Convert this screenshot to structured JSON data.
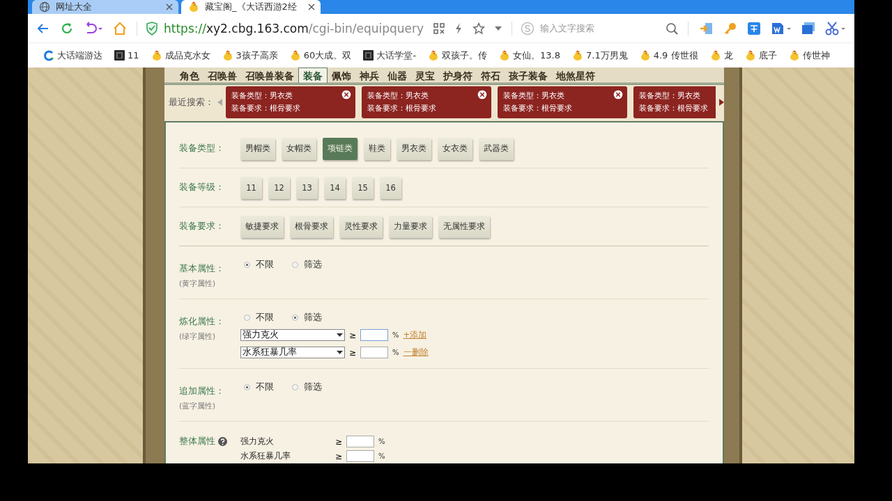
{
  "browser": {
    "tabs": [
      {
        "title": "网址大全",
        "selected": false
      },
      {
        "title": "藏宝阁_《大话西游2经",
        "selected": true
      }
    ],
    "address": {
      "scheme": "https://",
      "host": "xy2.cbg.163.com",
      "path": "/cgi-bin/equipquery"
    },
    "search": {
      "placeholder": "输入文字搜索"
    },
    "bookmarks": [
      "大话端游达",
      "11",
      "成品克水女",
      "3孩子高亲",
      "60大成。双",
      "大话学堂-",
      "双孩子。传",
      "女仙。13.8",
      "7.1万男鬼",
      "4.9 传世很",
      "龙",
      "底子",
      "传世神"
    ]
  },
  "game_tabs": [
    {
      "label": "角色",
      "selected": false
    },
    {
      "label": "召唤兽",
      "selected": false
    },
    {
      "label": "召唤兽装备",
      "selected": false
    },
    {
      "label": "装备",
      "selected": true
    },
    {
      "label": "佩饰",
      "selected": false
    },
    {
      "label": "神兵",
      "selected": false
    },
    {
      "label": "仙器",
      "selected": false
    },
    {
      "label": "灵宝",
      "selected": false
    },
    {
      "label": "护身符",
      "selected": false
    },
    {
      "label": "符石",
      "selected": false
    },
    {
      "label": "孩子装备",
      "selected": false
    },
    {
      "label": "地煞星符",
      "selected": false
    }
  ],
  "recent_searches": {
    "label": "最近搜索：",
    "items": [
      {
        "lines": [
          "装备类型：男衣类",
          "装备要求：根骨要求"
        ]
      },
      {
        "lines": [
          "装备类型：男衣类",
          "装备要求：根骨要求"
        ]
      },
      {
        "lines": [
          "装备类型：男衣类",
          "装备要求：根骨要求"
        ]
      },
      {
        "lines": [
          "装备类型：男衣类",
          "装备要求：根骨要求"
        ]
      }
    ]
  },
  "filters": [
    {
      "label": "装备类型：",
      "options": [
        {
          "label": "男帽类",
          "selected": false
        },
        {
          "label": "女帽类",
          "selected": false
        },
        {
          "label": "项链类",
          "selected": true
        },
        {
          "label": "鞋类",
          "selected": false
        },
        {
          "label": "男衣类",
          "selected": false
        },
        {
          "label": "女衣类",
          "selected": false
        },
        {
          "label": "武器类",
          "selected": false
        }
      ]
    },
    {
      "label": "装备等级：",
      "options": [
        {
          "label": "11",
          "selected": false
        },
        {
          "label": "12",
          "selected": false
        },
        {
          "label": "13",
          "selected": false
        },
        {
          "label": "14",
          "selected": false
        },
        {
          "label": "15",
          "selected": false
        },
        {
          "label": "16",
          "selected": false
        }
      ]
    },
    {
      "label": "装备要求：",
      "options": [
        {
          "label": "敏捷要求",
          "selected": false
        },
        {
          "label": "根骨要求",
          "selected": false
        },
        {
          "label": "灵性要求",
          "selected": false
        },
        {
          "label": "力量要求",
          "selected": false
        },
        {
          "label": "无属性要求",
          "selected": false
        }
      ]
    }
  ],
  "attributes": [
    {
      "label": "基本属性：",
      "sublabel": "(黄字属性)",
      "options": [
        {
          "label": "不限",
          "selected": true
        },
        {
          "label": "筛选",
          "selected": false
        }
      ]
    },
    {
      "label": "炼化属性：",
      "sublabel": "(绿字属性)",
      "options": [
        {
          "label": "不限",
          "selected": false
        },
        {
          "label": "筛选",
          "selected": true
        }
      ],
      "rows": [
        {
          "attribute": "强力克火",
          "sign": "≥",
          "unit": "%",
          "link": "+添加",
          "focused": true
        },
        {
          "attribute": "水系狂暴几率",
          "sign": "≥",
          "unit": "%",
          "link": "一删除",
          "focused": false
        }
      ]
    },
    {
      "label": "追加属性：",
      "sublabel": "(蓝字属性)",
      "options": [
        {
          "label": "不限",
          "selected": true
        },
        {
          "label": "筛选",
          "selected": false
        }
      ]
    }
  ],
  "overall": {
    "label": "整体属性",
    "rows": [
      {
        "attribute": "强力克火",
        "sign": "≥",
        "unit": "%"
      },
      {
        "attribute": "水系狂暴几率",
        "sign": "≥",
        "unit": "%"
      }
    ]
  }
}
